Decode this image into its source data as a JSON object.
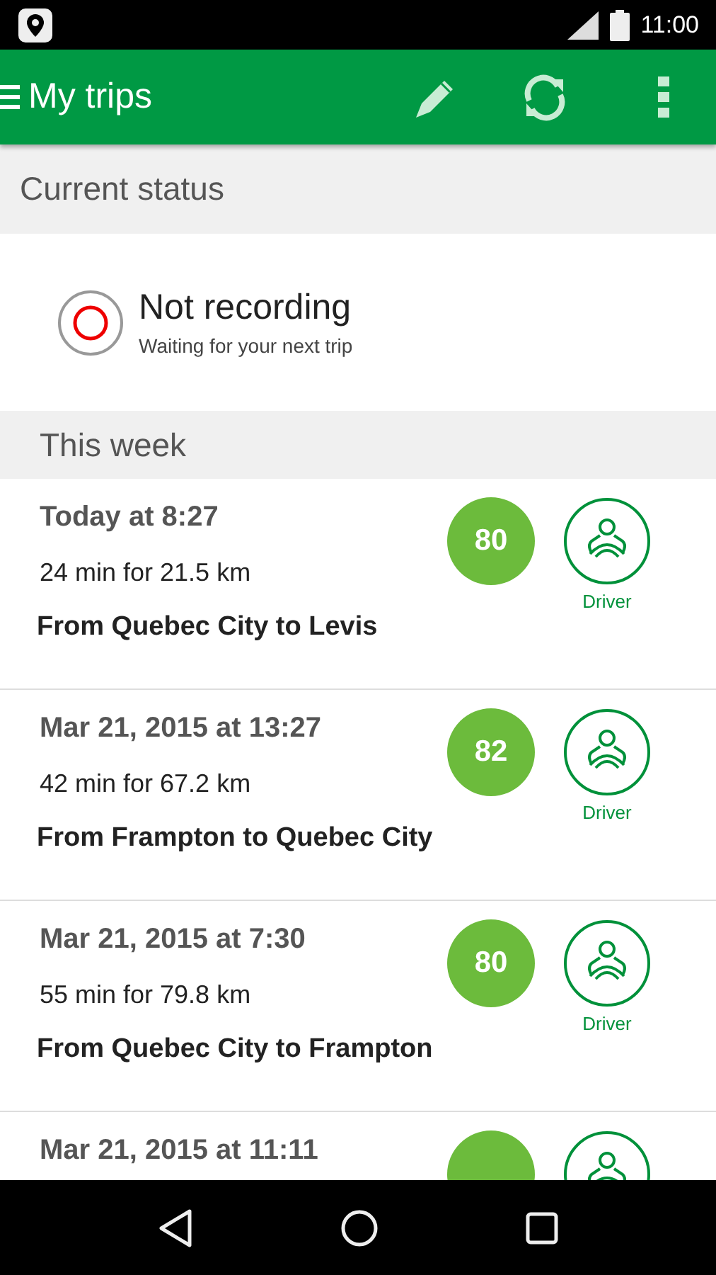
{
  "status_bar": {
    "time": "11:00"
  },
  "app_bar": {
    "title": "My trips"
  },
  "current_status": {
    "header": "Current status",
    "recording": false,
    "title": "Not recording",
    "subtitle": "Waiting for your next trip"
  },
  "week": {
    "header": "This week",
    "trips": [
      {
        "date": "Today at 8:27",
        "duration": "24 min for 21.5 km",
        "route": "From Quebec City to Levis",
        "score": "80",
        "role": "Driver"
      },
      {
        "date": "Mar 21, 2015 at 13:27",
        "duration": "42 min for 67.2 km",
        "route": "From Frampton to Quebec City",
        "score": "82",
        "role": "Driver"
      },
      {
        "date": "Mar 21, 2015 at 7:30",
        "duration": "55 min for 79.8 km",
        "route": "From Quebec City to Frampton",
        "score": "80",
        "role": "Driver"
      },
      {
        "date": "Mar 21, 2015 at 11:11"
      }
    ]
  }
}
